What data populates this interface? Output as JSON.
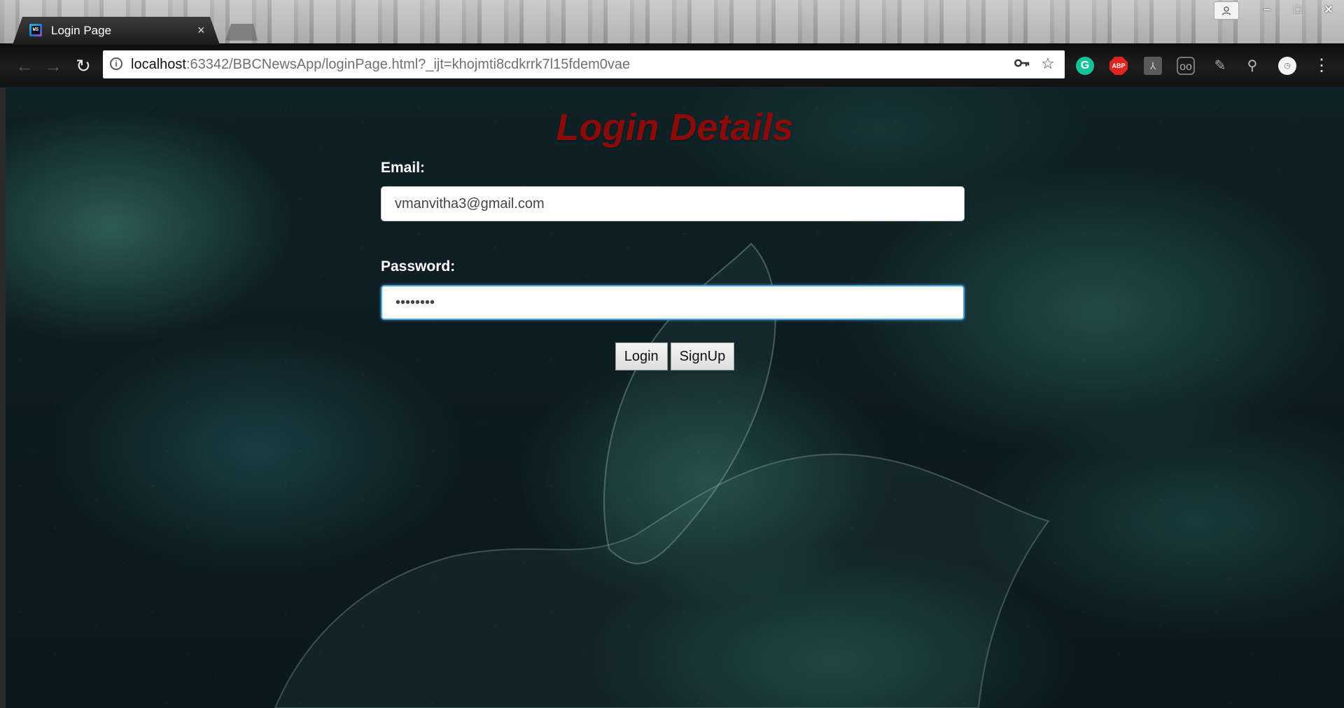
{
  "browser": {
    "tab_title": "Login Page",
    "tab_close": "×",
    "favicon_text": "WS",
    "url_host": "localhost",
    "url_rest": ":63342/BBCNewsApp/loginPage.html?_ijt=khojmti8cdkrrk7l15fdem0vae",
    "icons": [
      "info-icon",
      "key-icon",
      "star-icon",
      "grammarly-icon",
      "adblock-plus-icon",
      "pdf-icon",
      "glasses-icon",
      "pen-icon",
      "search-icon",
      "clock-icon",
      "menu-icon"
    ],
    "extensions": {
      "grammarly": "G",
      "abp": "ABP"
    },
    "window_controls": {
      "minimize": "–",
      "maximize": "□",
      "close": "✕"
    }
  },
  "page": {
    "heading": "Login Details",
    "heading_color": "#8b0b0b",
    "email": {
      "label": "Email:",
      "value": "vmanvitha3@gmail.com"
    },
    "password": {
      "label": "Password:",
      "value": "••••••••"
    },
    "buttons": {
      "login": "Login",
      "signup": "SignUp"
    }
  }
}
